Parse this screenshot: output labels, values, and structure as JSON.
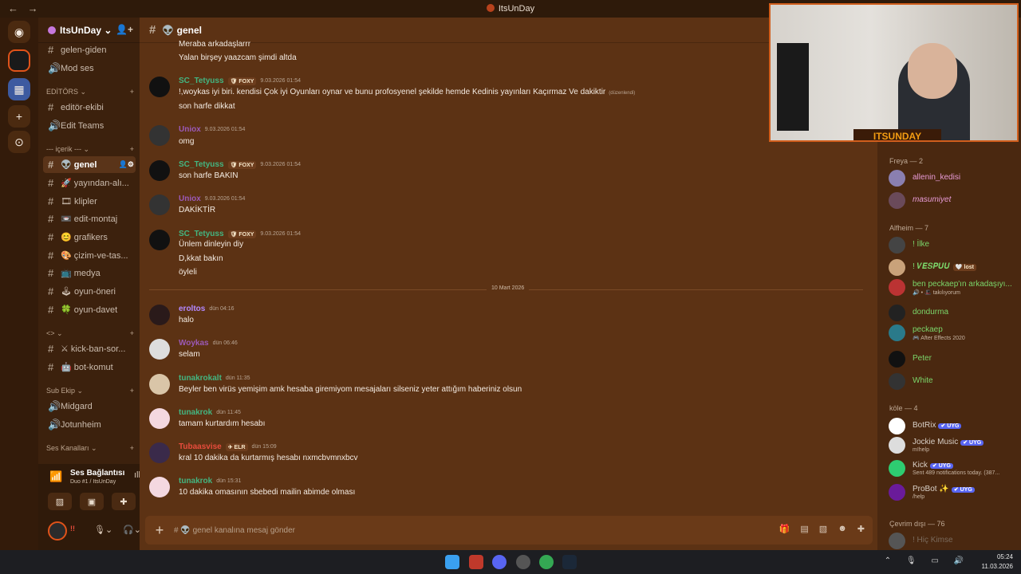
{
  "window": {
    "title": "ItsUnDay",
    "nav": "← →"
  },
  "server": {
    "name": "ItsUnDay ⌄",
    "invite_icon": "add-user-icon"
  },
  "channels": [
    {
      "type": "text",
      "label": "gelen-giden",
      "top": 0
    },
    {
      "type": "voice",
      "label": "Mod ses"
    },
    {
      "type": "category",
      "label": "EDİTÖRS ⌄"
    },
    {
      "type": "text",
      "label": "editör-ekibi"
    },
    {
      "type": "voice",
      "label": "Edit Teams"
    },
    {
      "type": "category",
      "label": "--- içerik --- ⌄"
    },
    {
      "type": "text",
      "label": "👽 genel",
      "selected": true
    },
    {
      "type": "text",
      "label": "🚀 yayından-alı..."
    },
    {
      "type": "text",
      "label": "🎞 klipler"
    },
    {
      "type": "text",
      "label": "📼 edit-montaj"
    },
    {
      "type": "text",
      "label": "😊 grafikers"
    },
    {
      "type": "text",
      "label": "🎨 çizim-ve-tas..."
    },
    {
      "type": "text",
      "label": "📺 medya"
    },
    {
      "type": "text",
      "label": "🕹 oyun-öneri"
    },
    {
      "type": "text",
      "label": "🍀 oyun-davet"
    },
    {
      "type": "category",
      "label": "<> ⌄"
    },
    {
      "type": "text",
      "label": "⚔ kick-ban-sor..."
    },
    {
      "type": "text",
      "label": "🤖 bot-komut"
    },
    {
      "type": "category",
      "label": "Sub Ekip ⌄"
    },
    {
      "type": "voice",
      "label": "Midgard"
    },
    {
      "type": "voice",
      "label": "Jotunheim"
    },
    {
      "type": "category",
      "label": "Ses Kanalları ⌄"
    }
  ],
  "voice_status": {
    "title": "Ses Bağlantısı K",
    "sub": "Duo #1 / ItsUnDay"
  },
  "user_panel": {
    "name": "!!"
  },
  "chat": {
    "channel": "👽 genel",
    "placeholder": "# 👽 genel kanalına mesaj gönder",
    "date_divider": "10 Mart 2026",
    "messages": [
      {
        "lines": [
          "Meraba arkadaşlarrr",
          "Yalan birşey yaazcam şimdi altda"
        ]
      },
      {
        "user": "SC_Tetyuss",
        "color": "#43b581",
        "tag": "🛡 FOXY",
        "time": "9.03.2026 01:54",
        "lines": [
          "!,woykas iyi biri. kendisi Çok iyi Oyunları oynar ve bunu profosyenel şekilde hemde Kedinis yayınları Kaçırmaz Ve dakiktir",
          "son harfe  dikkat"
        ],
        "edited": "(düzenlendi)"
      },
      {
        "user": "Uniox",
        "color": "#9b59b6",
        "time": "9.03.2026 01:54",
        "lines": [
          "omg"
        ]
      },
      {
        "user": "SC_Tetyuss",
        "color": "#43b581",
        "tag": "🛡 FOXY",
        "time": "9.03.2026 01:54",
        "lines": [
          "son harfe BAKIN"
        ]
      },
      {
        "user": "Uniox",
        "color": "#9b59b6",
        "time": "9.03.2026 01:54",
        "lines": [
          "DAKİKTİR"
        ]
      },
      {
        "user": "SC_Tetyuss",
        "color": "#43b581",
        "tag": "🛡 FOXY",
        "time": "9.03.2026 01:54",
        "lines": [
          "Ünlem dinleyin diy",
          "D,kkat bakın",
          "öyleli"
        ]
      },
      {
        "user": "eroltos",
        "color": "#b388ff",
        "time": "dün 04:16",
        "lines": [
          "halo"
        ]
      },
      {
        "user": "Woykas",
        "color": "#9b59b6",
        "time": "dün 06:46",
        "lines": [
          "selam"
        ]
      },
      {
        "user": "tunakrokalt",
        "color": "#43b581",
        "time": "dün 11:35",
        "lines": [
          "Beyler ben virüs yemişim amk hesaba giremiyom mesajaları silseniz yeter attığım haberiniz olsun"
        ]
      },
      {
        "user": "tunakrok",
        "color": "#43b581",
        "time": "dün 11:45",
        "lines": [
          "tamam kurtardım hesabı"
        ]
      },
      {
        "user": "Tubaasvise",
        "color": "#e74c3c",
        "tag": "✈ ELR",
        "time": "dün 15:09",
        "lines": [
          "kral 10 dakika da kurtarmış hesabı nxmcbvmnxbcv"
        ]
      },
      {
        "user": "tunakrok",
        "color": "#43b581",
        "time": "dün 15:31",
        "lines": [
          "10 dakika omasının sbebedi mailin abimde olması"
        ]
      }
    ]
  },
  "stream_overlay": {
    "label": "ITSUNDAY"
  },
  "members": {
    "groups": [
      {
        "name": "Freya — 2",
        "members": [
          {
            "name": "allenin_kedisi",
            "color": "#e89bd6"
          },
          {
            "name": "masumiyet",
            "color": "#e89bd6",
            "italic": true
          }
        ]
      },
      {
        "name": "Alfheim — 7",
        "members": [
          {
            "name": "! İlke",
            "color": "#7bd66a"
          },
          {
            "name": "! 𝑽𝑬𝑺𝑷𝑼𝑼",
            "color": "#7bd66a",
            "extra": "🤍 lost"
          },
          {
            "name": "ben peckaep'ın arkadaşıyı...",
            "color": "#7bd66a",
            "sub": "🔊 • 🎩 takılıyorum"
          },
          {
            "name": "dondurma",
            "color": "#7bd66a"
          },
          {
            "name": "peckaep",
            "color": "#7bd66a",
            "sub": "🎮 After Effects 2020"
          },
          {
            "name": "Peter",
            "color": "#7bd66a"
          },
          {
            "name": "White",
            "color": "#7bd66a"
          }
        ]
      },
      {
        "name": "köle — 4",
        "members": [
          {
            "name": "BotRix",
            "color": "#d9d0c7",
            "badge": "✔ UYG"
          },
          {
            "name": "Jockie Music",
            "color": "#d9d0c7",
            "badge": "✔ UYG",
            "sub": "m!help"
          },
          {
            "name": "Kick",
            "color": "#d9d0c7",
            "badge": "✔ UYG",
            "sub": "Sent 489 notifications today. (387..."
          },
          {
            "name": "ProBot ✨",
            "color": "#d9d0c7",
            "badge": "✔ UYG",
            "sub": "/help"
          }
        ]
      },
      {
        "name": "Çevrim dışı — 76",
        "members": [
          {
            "name": "! Hiç Kimse",
            "color": "#7a6a5c"
          }
        ]
      }
    ]
  },
  "taskbar": {
    "time": "05:24",
    "date": "11.03.2026"
  }
}
